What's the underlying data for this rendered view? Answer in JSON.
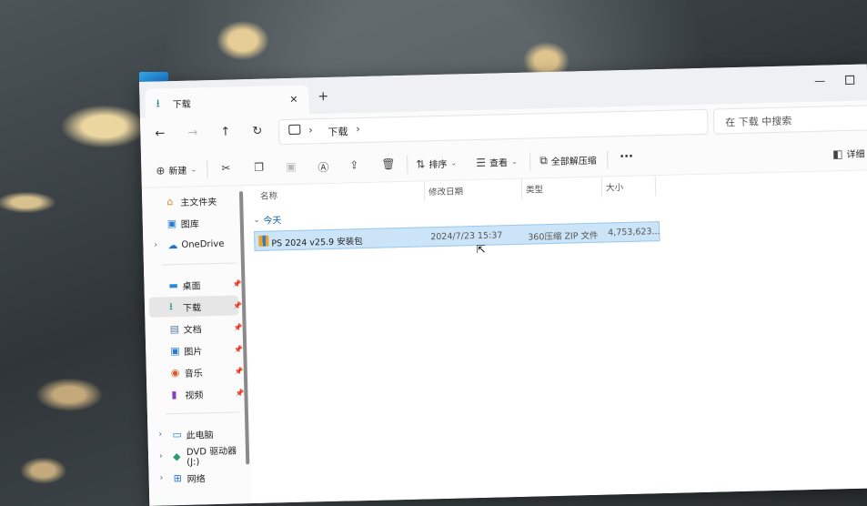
{
  "window": {
    "tab_title": "下载",
    "tab_close": "✕",
    "new_tab": "+",
    "minimize": "—"
  },
  "nav": {
    "back": "←",
    "forward": "→",
    "up": "↑",
    "refresh": "↻",
    "breadcrumb": [
      "下载"
    ],
    "search_placeholder": "在 下载 中搜索"
  },
  "toolbar": {
    "new_label": "新建",
    "sort_label": "排序",
    "view_label": "查看",
    "extract_label": "全部解压缩",
    "more_label": "···",
    "details_label": "详细"
  },
  "sidebar": {
    "items": [
      {
        "label": "主文件夹",
        "icon": "home-icon"
      },
      {
        "label": "图库",
        "icon": "gallery-icon"
      },
      {
        "label": "OneDrive",
        "icon": "cloud-icon"
      },
      {
        "label": "桌面",
        "icon": "desktop-icon"
      },
      {
        "label": "下载",
        "icon": "download-icon"
      },
      {
        "label": "文档",
        "icon": "document-icon"
      },
      {
        "label": "图片",
        "icon": "pictures-icon"
      },
      {
        "label": "音乐",
        "icon": "music-icon"
      },
      {
        "label": "视频",
        "icon": "video-icon"
      },
      {
        "label": "此电脑",
        "icon": "pc-icon"
      },
      {
        "label": "DVD 驱动器 (J:)",
        "icon": "dvd-icon"
      },
      {
        "label": "网络",
        "icon": "network-icon"
      }
    ]
  },
  "columns": {
    "name": "名称",
    "modified": "修改日期",
    "type": "类型",
    "size": "大小"
  },
  "group": {
    "label": "今天"
  },
  "files": [
    {
      "name": "PS 2024 v25.9 安装包",
      "modified": "2024/7/23 15:37",
      "type": "360压缩 ZIP 文件",
      "size": "4,753,623..."
    }
  ],
  "colors": {
    "selection": "#cce4f7",
    "accent": "#0f5fa6"
  }
}
